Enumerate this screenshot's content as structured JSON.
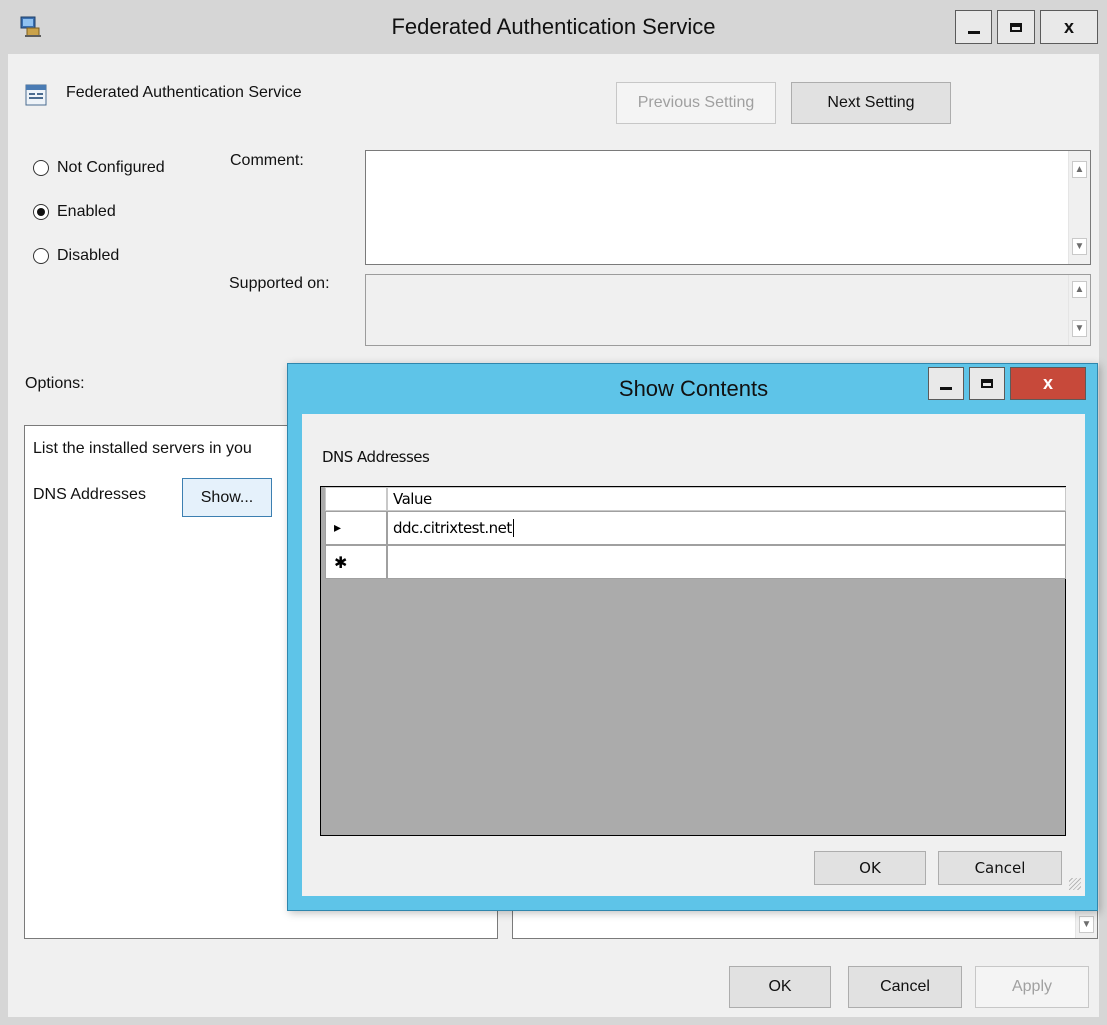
{
  "main_window": {
    "title": "Federated Authentication Service",
    "setting_name": "Federated Authentication Service",
    "previous_setting": "Previous Setting",
    "next_setting": "Next Setting",
    "radio": {
      "not_configured": "Not Configured",
      "enabled": "Enabled",
      "disabled": "Disabled",
      "selected": "Enabled"
    },
    "comment_label": "Comment:",
    "supported_on_label": "Supported on:",
    "options_label": "Options:",
    "options_text": "List the installed servers in you",
    "dns_label": "DNS Addresses",
    "show_button": "Show...",
    "ok": "OK",
    "cancel": "Cancel",
    "apply": "Apply",
    "minimize_glyph": "–",
    "close_glyph": "x"
  },
  "dialog": {
    "title": "Show Contents",
    "list_label": "DNS Addresses",
    "column_header": "Value",
    "rows": [
      {
        "marker": "▸",
        "value": "ddc.citrixtest.net"
      },
      {
        "marker": "✱",
        "value": ""
      }
    ],
    "ok": "OK",
    "cancel": "Cancel"
  },
  "icons": [
    "app-icon",
    "policy-setting-icon",
    "minimize-icon",
    "maximize-icon",
    "close-icon",
    "scroll-up-icon",
    "scroll-down-icon",
    "current-row-icon",
    "new-row-icon",
    "resize-grip-icon"
  ],
  "colors": {
    "dialog_frame": "#5ec4e8",
    "close_button": "#c7493a",
    "window_chrome": "#d6d6d6",
    "client_bg": "#f0f0f0"
  }
}
